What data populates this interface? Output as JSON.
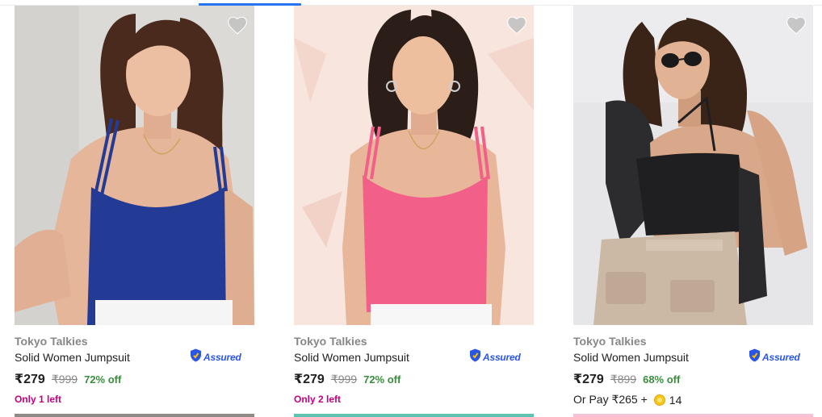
{
  "colors": {
    "accent": "#2874f0",
    "discount": "#388e3c",
    "stock_alert": "#c6007e",
    "assured": "#2a55e5"
  },
  "products": [
    {
      "brand": "Tokyo Talkies",
      "title": "Solid Women Jumpsuit",
      "assured_label": "Assured",
      "price": "₹279",
      "mrp": "₹999",
      "discount": "72% off",
      "stock_note": "Only 1 left",
      "image_desc": "woman in blue ribbed strappy top",
      "wishlist_icon": "heart-icon"
    },
    {
      "brand": "Tokyo Talkies",
      "title": "Solid Women Jumpsuit",
      "assured_label": "Assured",
      "price": "₹279",
      "mrp": "₹999",
      "discount": "72% off",
      "stock_note": "Only 2 left",
      "image_desc": "woman in pink ribbed strappy top",
      "wishlist_icon": "heart-icon"
    },
    {
      "brand": "Tokyo Talkies",
      "title": "Solid Women Jumpsuit",
      "assured_label": "Assured",
      "price": "₹279",
      "mrp": "₹899",
      "discount": "68% off",
      "pay_prefix": "Or Pay ₹265 +",
      "pay_coins": "14",
      "image_desc": "woman in black halter top with sunglasses",
      "wishlist_icon": "heart-icon"
    }
  ]
}
